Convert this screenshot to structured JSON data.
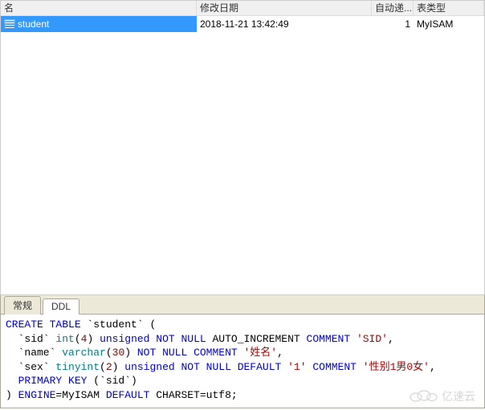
{
  "columns": {
    "name": "名",
    "modified": "修改日期",
    "auto": "自动递...",
    "type": "表类型"
  },
  "row": {
    "name": "student",
    "modified": "2018-11-21 13:42:49",
    "auto": "1",
    "type": "MyISAM"
  },
  "tabs": {
    "general": "常规",
    "ddl": "DDL"
  },
  "ddl": {
    "l1_a": "CREATE TABLE",
    "l1_b": " `student` (",
    "l2_a": "  `sid` ",
    "l2_b": "int",
    "l2_c": "(",
    "l2_d": "4",
    "l2_e": ") ",
    "l2_f": "unsigned NOT NULL",
    "l2_g": " AUTO_INCREMENT ",
    "l2_h": "COMMENT",
    "l2_i": " ",
    "l2_j": "'SID'",
    "l2_k": ",",
    "l3_a": "  `name` ",
    "l3_b": "varchar",
    "l3_c": "(",
    "l3_d": "30",
    "l3_e": ") ",
    "l3_f": "NOT NULL COMMENT",
    "l3_g": " ",
    "l3_h": "'姓名'",
    "l3_i": ",",
    "l4_a": "  `sex` ",
    "l4_b": "tinyint",
    "l4_c": "(",
    "l4_d": "2",
    "l4_e": ") ",
    "l4_f": "unsigned NOT NULL DEFAULT",
    "l4_g": " ",
    "l4_h": "'1'",
    "l4_i": " ",
    "l4_j": "COMMENT",
    "l4_k": " ",
    "l4_l": "'性别1男0女'",
    "l4_m": ",",
    "l5_a": "  PRIMARY KEY",
    "l5_b": " (`sid`)",
    "l6_a": ") ",
    "l6_b": "ENGINE",
    "l6_c": "=MyISAM ",
    "l6_d": "DEFAULT",
    "l6_e": " CHARSET=utf8;"
  },
  "watermark": "亿速云"
}
